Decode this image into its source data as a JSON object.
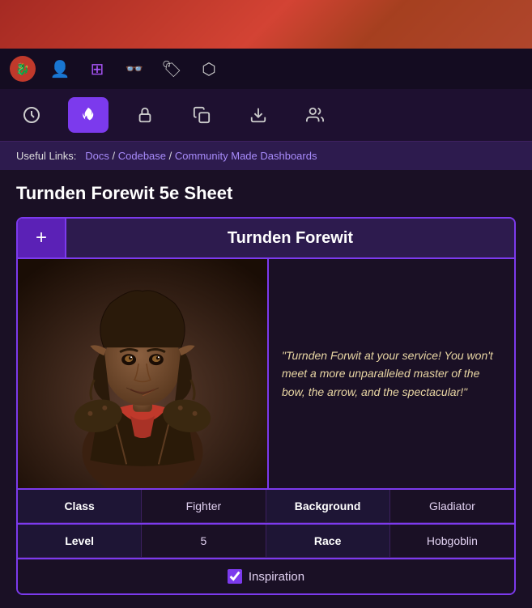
{
  "topBg": {},
  "topNav": {
    "brandIcon": "🔴",
    "icons": [
      {
        "name": "user-icon",
        "glyph": "👤"
      },
      {
        "name": "grid-icon",
        "glyph": "⊞"
      },
      {
        "name": "glasses-icon",
        "glyph": "👓"
      },
      {
        "name": "tag-icon",
        "glyph": "🏷"
      },
      {
        "name": "dice-icon",
        "glyph": "⬡"
      }
    ]
  },
  "tabs": [
    {
      "name": "tab-clock",
      "glyph": "⏰",
      "active": false
    },
    {
      "name": "tab-flame",
      "glyph": "🔥",
      "active": true
    },
    {
      "name": "tab-lock",
      "glyph": "🔒",
      "active": false
    },
    {
      "name": "tab-copy",
      "glyph": "📋",
      "active": false
    },
    {
      "name": "tab-download",
      "glyph": "⬇",
      "active": false
    },
    {
      "name": "tab-users",
      "glyph": "👥",
      "active": false
    }
  ],
  "linksBar": {
    "label": "Useful Links:",
    "links": [
      {
        "text": "Docs",
        "url": "#"
      },
      {
        "text": "Codebase",
        "url": "#"
      },
      {
        "text": "Community Made Dashboards",
        "url": "#"
      }
    ]
  },
  "sheetTitle": "Turnden Forewit 5e Sheet",
  "characterCard": {
    "characterName": "Turnden Forewit",
    "addButtonLabel": "+",
    "quote": "\"Turnden Forwit at your service! You won't meet a more unparalleled master of the bow, the arrow, and the spectacular!\"",
    "infoRows": [
      {
        "label1": "Class",
        "value1": "Fighter",
        "label2": "Background",
        "value2": "Gladiator"
      },
      {
        "label1": "Level",
        "value1": "5",
        "label2": "Race",
        "value2": "Hobgoblin"
      }
    ],
    "inspirationChecked": true,
    "inspirationLabel": "Inspiration"
  },
  "colors": {
    "accent": "#7c3aed",
    "accentLight": "#a78bfa",
    "bg": "#1a1025",
    "cardBg": "#1e1535"
  }
}
